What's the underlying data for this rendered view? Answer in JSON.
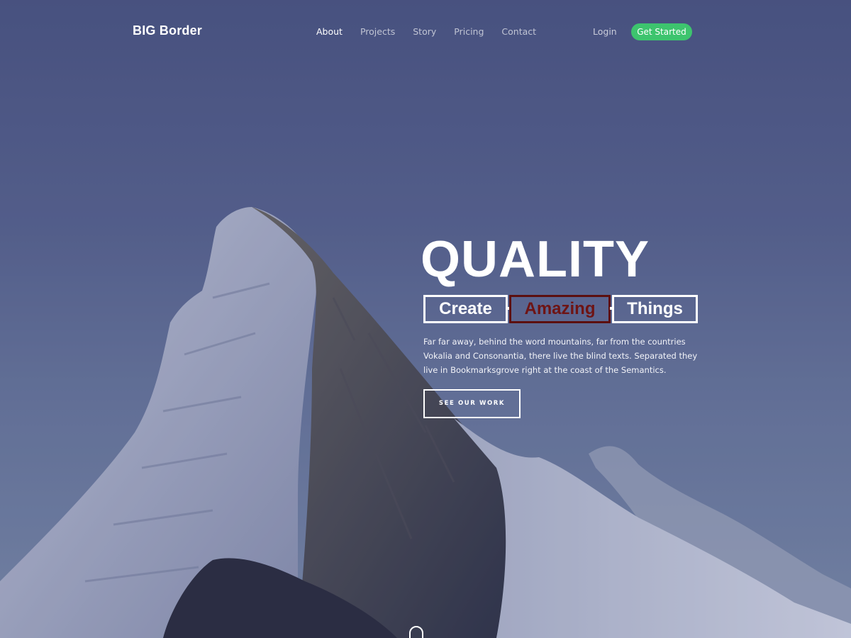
{
  "brand": "BIG Border",
  "nav": {
    "links": [
      "About",
      "Projects",
      "Story",
      "Pricing",
      "Contact"
    ],
    "active_index": 0,
    "login": "Login",
    "cta": "Get Started"
  },
  "hero": {
    "headline": "QUALITY",
    "words": [
      "Create",
      "Amazing",
      "Things"
    ],
    "paragraph": "Far far away, behind the word mountains, far from the countries Vokalia and Consonantia, there live the blind texts. Separated they live in Bookmarksgrove right at the coast of the Semantics.",
    "button": "SEE OUR WORK"
  },
  "colors": {
    "accent_green": "#3dc46e",
    "highlight_dark_red": "#5c0f0f",
    "sky": "#5a6690"
  },
  "icons": {
    "scroll": "mouse-scroll-icon"
  }
}
